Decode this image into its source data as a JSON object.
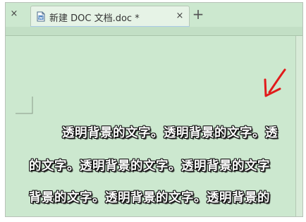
{
  "tabbar": {
    "left_close_symbol": "×",
    "active_tab": {
      "title": "新建 DOC 文档.doc *",
      "icon": "doc-file-icon",
      "close_symbol": "×"
    },
    "new_tab_symbol": "+"
  },
  "document": {
    "lines": [
      "透明背景的文字。透明背景的文字。透",
      "的文字。透明背景的文字。透明背景的文字",
      "背景的文字。透明背景的文字。透明背景的"
    ],
    "text_style": "white text with black outline",
    "annotation_icon": "red-arrow-icon"
  },
  "colors": {
    "background": "#cce8cf",
    "tab_background": "#e6f3e6",
    "arrow": "#e11b1b",
    "text_fill": "#ffffff",
    "text_outline": "#111111"
  }
}
